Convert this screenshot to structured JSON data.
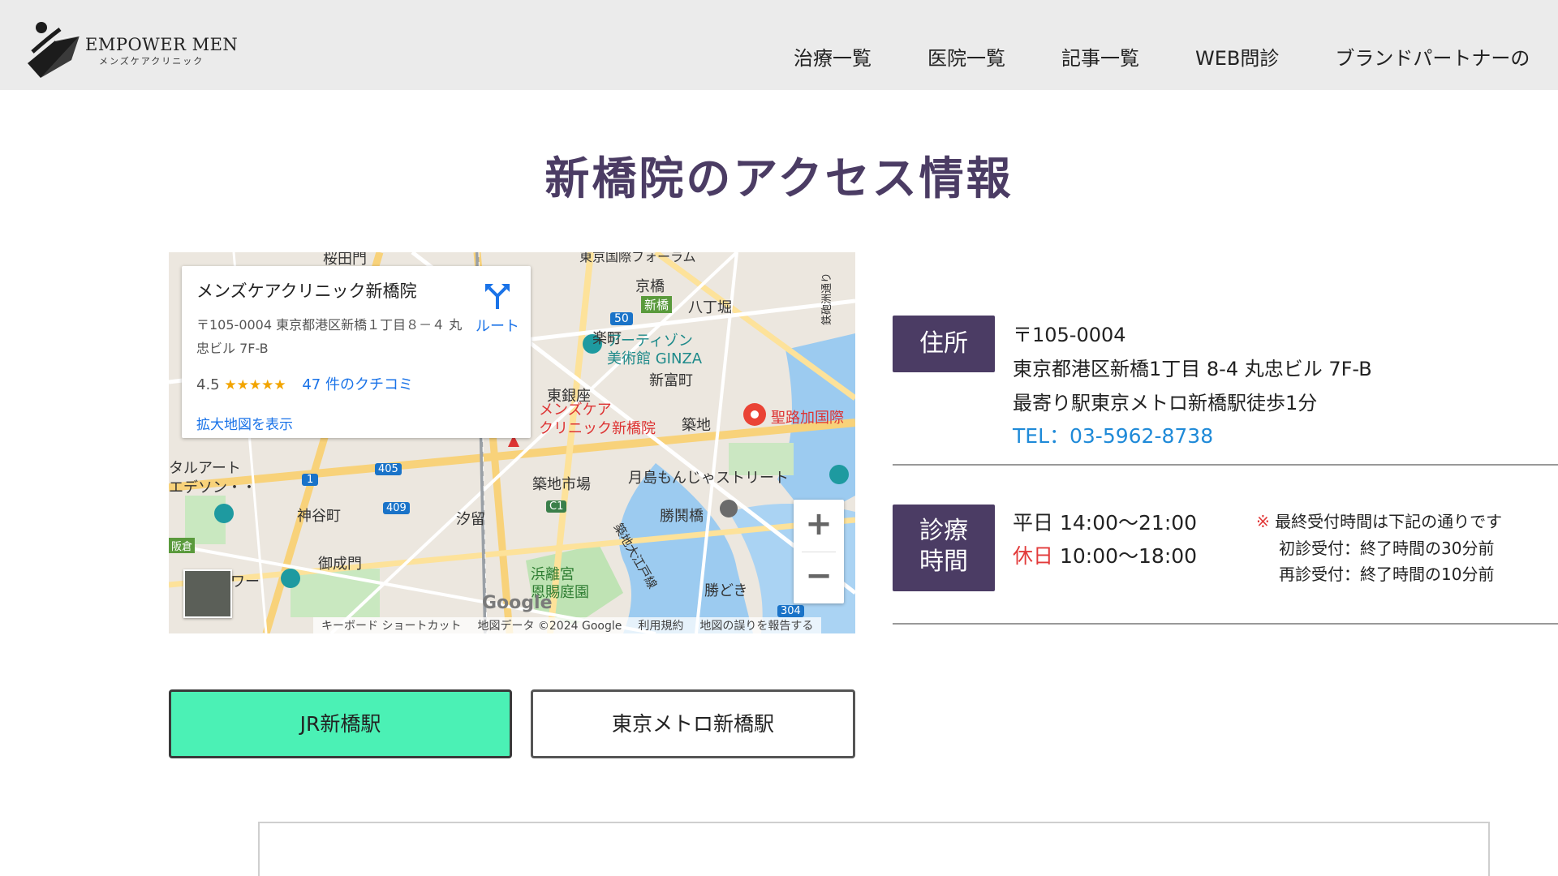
{
  "header": {
    "logo_title": "EMPOWER MEN",
    "logo_sub": "メンズケアクリニック",
    "nav": [
      "治療一覧",
      "医院一覧",
      "記事一覧",
      "WEB問診",
      "ブランドパートナーの"
    ]
  },
  "page_title": "新橋院のアクセス情報",
  "map": {
    "card": {
      "name": "メンズケアクリニック新橋院",
      "address": "〒105-0004 東京都港区新橋１丁目８－４ 丸忠ビル 7F-B",
      "rating": "4.5",
      "stars": "★★★★★",
      "reviews": "47 件のクチコミ",
      "enlarge": "拡大地図を表示",
      "route": "ルート"
    },
    "labels": {
      "shinbashi_station": "新橋",
      "hatchobori": "八丁堀",
      "kyobashi": "京橋",
      "yurakucho": "楽町",
      "aquarium": "アーティゾン美術館 GINZA",
      "aquarium_l1": "アーティゾン",
      "aquarium_l2": "美術館 GINZA",
      "shintomicho": "新富町",
      "higashiginza": "東銀座",
      "tsukiji": "築地",
      "clinic_l1": "メンズケア",
      "clinic_l2": "クリニック新橋院",
      "hospital": "聖路加国際",
      "tsukiji_market": "築地市場",
      "monja": "月島もんじゃストリート",
      "kachidoki_bridge": "勝鬨橋",
      "shiodome": "汐留",
      "toranomon": "神谷町",
      "onarimon": "御成門",
      "hamarikyu_l1": "浜離宮",
      "hamarikyu_l2": "恩賜庭園",
      "kachidoki": "勝どき",
      "art_l1": "タルアート",
      "art_l2": "エデソン・・",
      "tower": "ワー",
      "hanzomon": "桜田門",
      "kyobashi_top": "東京国際フォーラム",
      "route_50": "50",
      "route_405": "405",
      "route_409": "409",
      "route_1": "1",
      "route_304": "304",
      "route_c1": "C1",
      "sign_hanzo": "阪倉",
      "river": "築地大江戸線",
      "right_road": "鉄砲洲通り"
    },
    "google": "Google",
    "footer": [
      "キーボード ショートカット",
      "地図データ ©2024 Google",
      "利用規約",
      "地図の誤りを報告する"
    ],
    "zoom_in": "+",
    "zoom_out": "−"
  },
  "buttons": {
    "jr": "JR新橋駅",
    "metro": "東京メトロ新橋駅"
  },
  "address": {
    "label": "住所",
    "zip": "〒105-0004",
    "line": "東京都港区新橋1丁目 8-4 丸忠ビル 7F-B",
    "station": "最寄り駅東京メトロ新橋駅徒歩1分",
    "tel": "TEL：03-5962-8738"
  },
  "hours": {
    "label_1": "診療",
    "label_2": "時間",
    "weekday_label": "平日",
    "weekday_time": "14:00〜21:00",
    "holiday_label": "休日",
    "holiday_time": "10:00〜18:00",
    "note_mark": "※",
    "note_1": "最終受付時間は下記の通りです",
    "note_2": "初診受付：終了時間の30分前",
    "note_3": "再診受付：終了時間の10分前"
  },
  "colors": {
    "accent": "#4b3c64",
    "jr_button": "#4bf1b5",
    "tel": "#1f8ad8",
    "holiday": "#e23b3b"
  }
}
